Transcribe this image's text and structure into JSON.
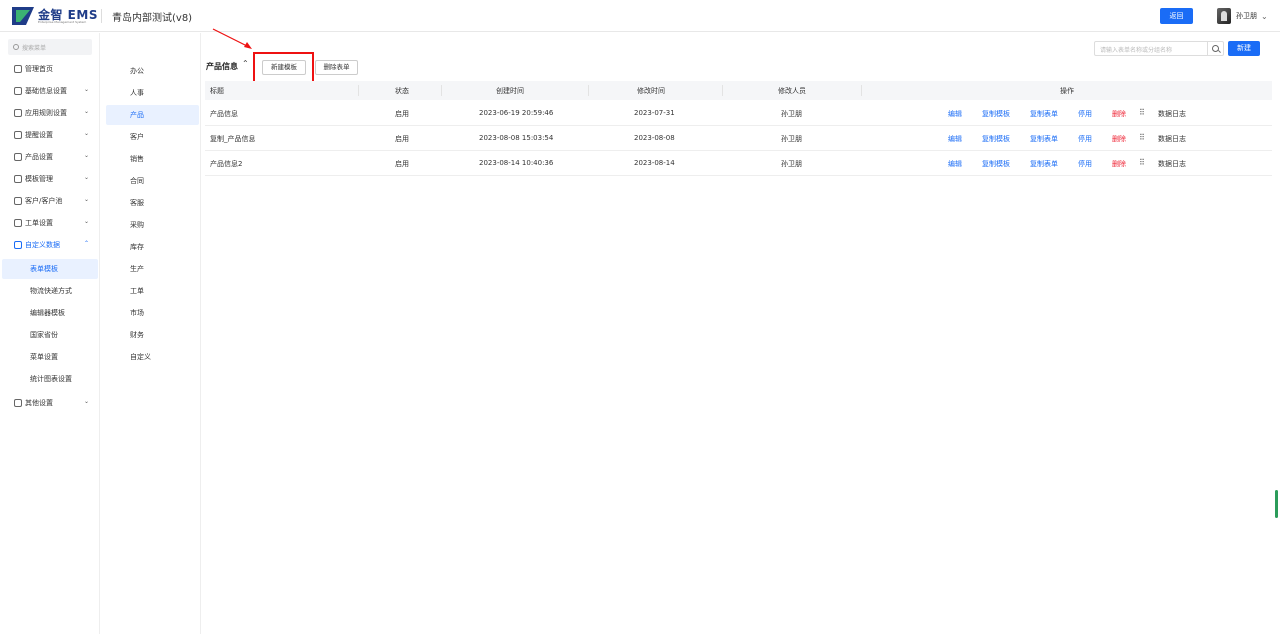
{
  "header": {
    "logo_text": "金智 EMS",
    "logo_sub": "Enterprise Management System",
    "system_title": "青岛内部测试(v8)",
    "back_label": "返回",
    "user_name": "孙卫朋"
  },
  "sidebar": {
    "search_placeholder": "搜索菜单",
    "items": [
      {
        "label": "管理首页",
        "icon": "home-icon"
      },
      {
        "label": "基础信息设置",
        "icon": "gear-icon"
      },
      {
        "label": "应用规则设置",
        "icon": "document-icon"
      },
      {
        "label": "提醒设置",
        "icon": "bell-icon"
      },
      {
        "label": "产品设置",
        "icon": "cube-icon"
      },
      {
        "label": "模板管理",
        "icon": "template-icon"
      },
      {
        "label": "客户/客户池",
        "icon": "users-icon"
      },
      {
        "label": "工单设置",
        "icon": "ticket-icon"
      },
      {
        "label": "自定义数据",
        "icon": "custom-data-icon"
      }
    ],
    "sub_items": [
      "表单模板",
      "物流快递方式",
      "编辑器模板",
      "国家省份",
      "菜单设置",
      "统计图表设置"
    ],
    "other_item": {
      "label": "其他设置",
      "icon": "grid-icon"
    }
  },
  "categories": [
    "办公",
    "人事",
    "产品",
    "客户",
    "销售",
    "合同",
    "客服",
    "采购",
    "库存",
    "生产",
    "工单",
    "市场",
    "财务",
    "自定义"
  ],
  "toolbar": {
    "search_placeholder": "请输入表单名称或分组名称",
    "new_label": "新建"
  },
  "section": {
    "title": "产品信息",
    "new_template_label": "新建模板",
    "delete_form_label": "删除表单"
  },
  "table": {
    "columns": [
      "标题",
      "状态",
      "创建时间",
      "修改时间",
      "修改人员",
      "操作"
    ],
    "rows": [
      {
        "title": "产品信息",
        "status": "启用",
        "created": "2023-06-19 20:59:46",
        "modified": "2023-07-31",
        "modifier": "孙卫朋"
      },
      {
        "title": "复制_产品信息",
        "status": "启用",
        "created": "2023-08-08 15:03:54",
        "modified": "2023-08-08",
        "modifier": "孙卫朋"
      },
      {
        "title": "产品信息2",
        "status": "启用",
        "created": "2023-08-14 10:40:36",
        "modified": "2023-08-14",
        "modifier": "孙卫朋"
      }
    ],
    "actions": {
      "edit": "编辑",
      "copy_template": "复制模板",
      "copy_form": "复制表单",
      "disable": "停用",
      "delete": "删除",
      "data_log": "数据日志"
    }
  },
  "colors": {
    "accent": "#1a6cf6",
    "danger": "#e23",
    "highlight": "#e11"
  }
}
